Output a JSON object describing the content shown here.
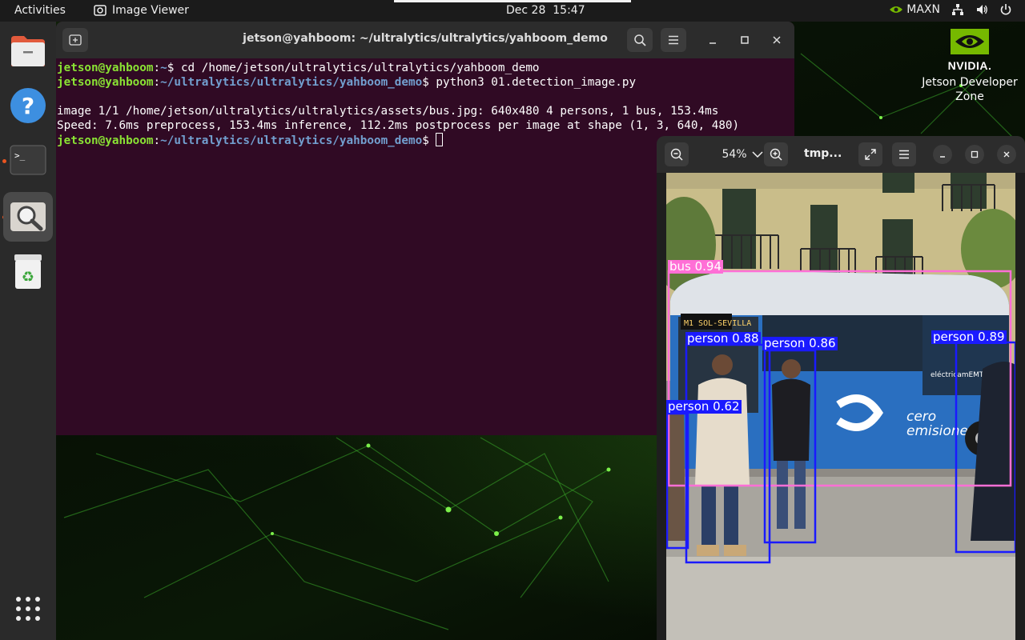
{
  "topbar": {
    "activities": "Activities",
    "app_name": "Image Viewer",
    "date": "Dec 28",
    "time": "15:47",
    "power_mode": "MAXN"
  },
  "desktop": {
    "brand": "NVIDIA.",
    "label": "Jetson Developer Zone"
  },
  "dock": {
    "items": [
      {
        "name": "files",
        "active": false,
        "running": false
      },
      {
        "name": "help",
        "active": false,
        "running": false
      },
      {
        "name": "terminal",
        "active": false,
        "running": true
      },
      {
        "name": "image-viewer",
        "active": true,
        "running": true
      },
      {
        "name": "trash",
        "active": false,
        "running": false
      }
    ]
  },
  "terminal": {
    "title": "jetson@yahboom: ~/ultralytics/ultralytics/yahboom_demo",
    "user_host": "jetson@yahboom",
    "lines": [
      {
        "path": "~",
        "cmd": "$ cd /home/jetson/ultralytics/ultralytics/yahboom_demo"
      },
      {
        "path": "~/ultralytics/ultralytics/yahboom_demo",
        "cmd": "$ python3 01.detection_image.py"
      }
    ],
    "output": [
      "",
      "image 1/1 /home/jetson/ultralytics/ultralytics/assets/bus.jpg: 640x480 4 persons, 1 bus, 153.4ms",
      "Speed: 7.6ms preprocess, 153.4ms inference, 112.2ms postprocess per image at shape (1, 3, 640, 480)"
    ],
    "prompt_path": "~/ultralytics/ultralytics/yahboom_demo",
    "prompt_suffix": "$ "
  },
  "viewer": {
    "zoom": "54%",
    "title": "tmp...",
    "photo_text": {
      "bus_side_1": "cero",
      "bus_side_2": "emisiones",
      "bus_ad": "eléctricamEMTe",
      "bus_route": "M1 SOL-SEVILLA"
    },
    "detections": [
      {
        "label": "bus 0.94",
        "color": "#ff5fd0"
      },
      {
        "label": "person 0.88",
        "color": "#1a1aff"
      },
      {
        "label": "person 0.86",
        "color": "#1a1aff"
      },
      {
        "label": "person 0.89",
        "color": "#1a1aff"
      },
      {
        "label": "person 0.62",
        "color": "#1a1aff"
      }
    ]
  }
}
